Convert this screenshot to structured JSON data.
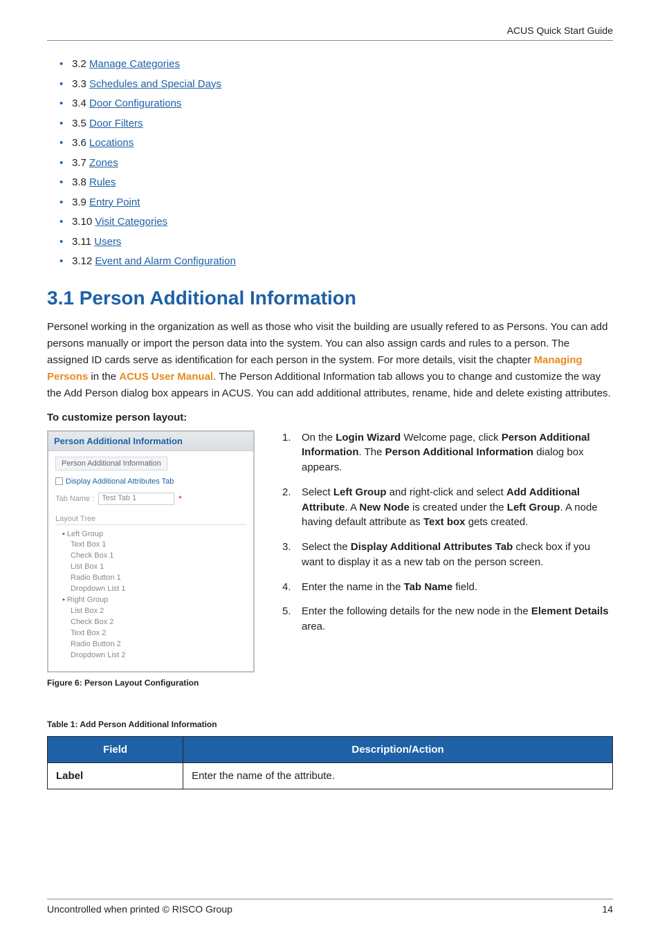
{
  "header": {
    "title": "ACUS Quick Start Guide"
  },
  "toc": [
    {
      "num": "3.2",
      "label": "Manage Categories"
    },
    {
      "num": "3.3",
      "label": "Schedules and Special Days"
    },
    {
      "num": "3.4",
      "label": "Door Configurations"
    },
    {
      "num": "3.5",
      "label": "Door Filters"
    },
    {
      "num": "3.6",
      "label": "Locations"
    },
    {
      "num": "3.7",
      "label": "Zones"
    },
    {
      "num": "3.8",
      "label": "Rules"
    },
    {
      "num": "3.9",
      "label": "Entry Point"
    },
    {
      "num": "3.10",
      "label": "Visit Categories"
    },
    {
      "num": "3.11",
      "label": "Users"
    },
    {
      "num": "3.12",
      "label": "Event and Alarm Configuration"
    }
  ],
  "section": {
    "heading": "3.1  Person Additional Information",
    "body_pre": "Personel working in the organization as well as those who visit the building are usually refered to as Persons. You can add persons manually or import the person data into the system. You can also assign cards and rules to a person. The assigned ID cards serve as identification for each person in the system. For more details, visit the chapter ",
    "body_link1": "Managing Persons",
    "body_mid": " in the ",
    "body_link2": "ACUS User Manual",
    "body_post": ". The Person Additional Information tab allows you to change and customize the way the Add Person dialog box appears in ACUS. You can add additional attributes, rename, hide and delete existing attributes.",
    "subhead": "To customize person layout:"
  },
  "dialog": {
    "title": "Person Additional Information",
    "tab": "Person Additional Information",
    "chk_label": "Display Additional Attributes Tab",
    "name_label": "Tab Name :",
    "name_value": "Test Tab 1",
    "tree_head": "Layout Tree",
    "tree": {
      "left": {
        "label": "Left Group",
        "children": [
          "Text Box 1",
          "Check Box 1",
          "List Box 1",
          "Radio Button 1",
          "Dropdown List 1"
        ]
      },
      "right": {
        "label": "Right Group",
        "children": [
          "List Box 2",
          "Check Box 2",
          "Text Box 2",
          "Radio Button 2",
          "Dropdown List 2"
        ]
      }
    }
  },
  "figure_caption": "Figure 6: Person Layout Configuration",
  "steps": {
    "s1_pre": "On the ",
    "s1_b1": "Login Wizard",
    "s1_mid1": " Welcome page, click ",
    "s1_b2": "Person Additional Information",
    "s1_mid2": ". The ",
    "s1_b3": "Person Additional Information",
    "s1_post": " dialog box appears.",
    "s2_pre": "Select ",
    "s2_b1": "Left Group",
    "s2_mid1": " and right-click and select ",
    "s2_b2": "Add Additional Attribute",
    "s2_mid2": ". A ",
    "s2_b3": "New Node",
    "s2_mid3": " is created under the ",
    "s2_b4": "Left Group",
    "s2_mid4": ". A node having default attribute as ",
    "s2_b5": "Text box",
    "s2_post": " gets created.",
    "s3_pre": "Select the ",
    "s3_b1": "Display Additional Attributes Tab",
    "s3_post": " check box if you want to display it as a new tab on the person screen.",
    "s4_pre": "Enter the name in the ",
    "s4_b1": "Tab Name",
    "s4_post": " field.",
    "s5_pre": "Enter the following details for the new node in the ",
    "s5_b1": "Element Details",
    "s5_post": " area."
  },
  "table": {
    "caption": "Table 1: Add Person Additional Information",
    "head_field": "Field",
    "head_desc": "Description/Action",
    "row_field": "Label",
    "row_desc": "Enter the name of the attribute."
  },
  "footer": {
    "left": "Uncontrolled when printed © RISCO Group",
    "right": "14"
  }
}
